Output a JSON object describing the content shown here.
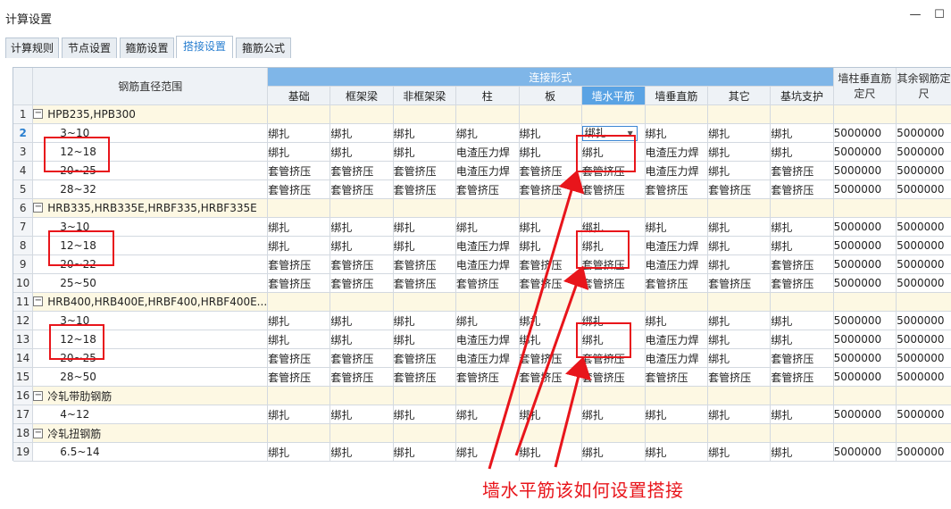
{
  "window": {
    "title": "计算设置",
    "minimize_glyph": "—",
    "maximize_glyph": "☐"
  },
  "tabs": [
    "计算规则",
    "节点设置",
    "箍筋设置",
    "搭接设置",
    "箍筋公式"
  ],
  "active_tab": 3,
  "table": {
    "header_range": "钢筋直径范围",
    "header_connection": "连接形式",
    "connection_columns": [
      "基础",
      "框架梁",
      "非框架梁",
      "柱",
      "板",
      "墙水平筋",
      "墙垂直筋",
      "其它",
      "基坑支护"
    ],
    "extra_columns": [
      "墙柱垂直筋定尺",
      "其余钢筋定尺"
    ],
    "rows": [
      {
        "no": "1",
        "group": true,
        "name": "HPB235,HPB300"
      },
      {
        "no": "2",
        "name": "3~10",
        "values": [
          "绑扎",
          "绑扎",
          "绑扎",
          "绑扎",
          "绑扎",
          "绑扎",
          "绑扎",
          "绑扎",
          "绑扎",
          "5000000",
          "5000000"
        ]
      },
      {
        "no": "3",
        "name": "12~18",
        "values": [
          "绑扎",
          "绑扎",
          "绑扎",
          "电渣压力焊",
          "绑扎",
          "绑扎",
          "电渣压力焊",
          "绑扎",
          "绑扎",
          "5000000",
          "5000000"
        ]
      },
      {
        "no": "4",
        "name": "20~25",
        "values": [
          "套管挤压",
          "套管挤压",
          "套管挤压",
          "电渣压力焊",
          "套管挤压",
          "套管挤压",
          "电渣压力焊",
          "绑扎",
          "套管挤压",
          "5000000",
          "5000000"
        ]
      },
      {
        "no": "5",
        "name": "28~32",
        "values": [
          "套管挤压",
          "套管挤压",
          "套管挤压",
          "套管挤压",
          "套管挤压",
          "套管挤压",
          "套管挤压",
          "套管挤压",
          "套管挤压",
          "5000000",
          "5000000"
        ]
      },
      {
        "no": "6",
        "group": true,
        "name": "HRB335,HRB335E,HRBF335,HRBF335E"
      },
      {
        "no": "7",
        "name": "3~10",
        "values": [
          "绑扎",
          "绑扎",
          "绑扎",
          "绑扎",
          "绑扎",
          "绑扎",
          "绑扎",
          "绑扎",
          "绑扎",
          "5000000",
          "5000000"
        ]
      },
      {
        "no": "8",
        "name": "12~18",
        "values": [
          "绑扎",
          "绑扎",
          "绑扎",
          "电渣压力焊",
          "绑扎",
          "绑扎",
          "电渣压力焊",
          "绑扎",
          "绑扎",
          "5000000",
          "5000000"
        ]
      },
      {
        "no": "9",
        "name": "20~22",
        "values": [
          "套管挤压",
          "套管挤压",
          "套管挤压",
          "电渣压力焊",
          "套管挤压",
          "套管挤压",
          "电渣压力焊",
          "绑扎",
          "套管挤压",
          "5000000",
          "5000000"
        ]
      },
      {
        "no": "10",
        "name": "25~50",
        "values": [
          "套管挤压",
          "套管挤压",
          "套管挤压",
          "套管挤压",
          "套管挤压",
          "套管挤压",
          "套管挤压",
          "套管挤压",
          "套管挤压",
          "5000000",
          "5000000"
        ]
      },
      {
        "no": "11",
        "group": true,
        "name": "HRB400,HRB400E,HRBF400,HRBF400E..."
      },
      {
        "no": "12",
        "name": "3~10",
        "values": [
          "绑扎",
          "绑扎",
          "绑扎",
          "绑扎",
          "绑扎",
          "绑扎",
          "绑扎",
          "绑扎",
          "绑扎",
          "5000000",
          "5000000"
        ]
      },
      {
        "no": "13",
        "name": "12~18",
        "values": [
          "绑扎",
          "绑扎",
          "绑扎",
          "电渣压力焊",
          "绑扎",
          "绑扎",
          "电渣压力焊",
          "绑扎",
          "绑扎",
          "5000000",
          "5000000"
        ]
      },
      {
        "no": "14",
        "name": "20~25",
        "values": [
          "套管挤压",
          "套管挤压",
          "套管挤压",
          "电渣压力焊",
          "套管挤压",
          "套管挤压",
          "电渣压力焊",
          "绑扎",
          "套管挤压",
          "5000000",
          "5000000"
        ]
      },
      {
        "no": "15",
        "name": "28~50",
        "values": [
          "套管挤压",
          "套管挤压",
          "套管挤压",
          "套管挤压",
          "套管挤压",
          "套管挤压",
          "套管挤压",
          "套管挤压",
          "套管挤压",
          "5000000",
          "5000000"
        ]
      },
      {
        "no": "16",
        "group": true,
        "name": "冷轧带肋钢筋"
      },
      {
        "no": "17",
        "name": "4~12",
        "values": [
          "绑扎",
          "绑扎",
          "绑扎",
          "绑扎",
          "绑扎",
          "绑扎",
          "绑扎",
          "绑扎",
          "绑扎",
          "5000000",
          "5000000"
        ]
      },
      {
        "no": "18",
        "group": true,
        "name": "冷轧扭钢筋"
      },
      {
        "no": "19",
        "name": "6.5~14",
        "values": [
          "绑扎",
          "绑扎",
          "绑扎",
          "绑扎",
          "绑扎",
          "绑扎",
          "绑扎",
          "绑扎",
          "绑扎",
          "5000000",
          "5000000"
        ]
      }
    ],
    "selected_row": "2",
    "active_column": "墙水平筋",
    "expander_glyph": "−",
    "dropdown_glyph": "▼"
  },
  "annotation": {
    "text": "墙水平筋该如何设置搭接",
    "color": "#e8151b"
  },
  "colors": {
    "accent": "#2a7fd0",
    "header_band": "#7fb6e8",
    "active_header": "#5aa3e4",
    "group_row": "#fdf8e3",
    "annotation_red": "#e8151b"
  }
}
